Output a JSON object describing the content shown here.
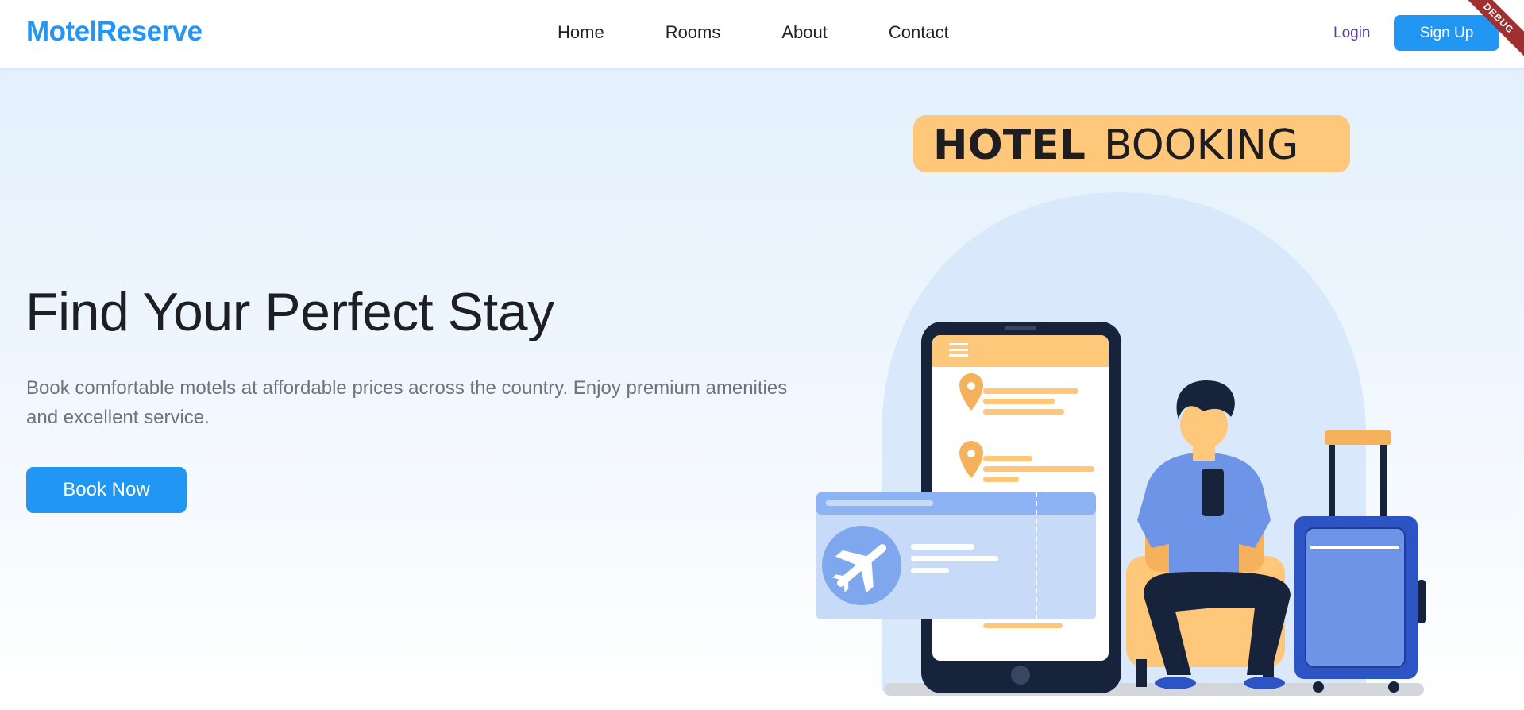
{
  "brand": {
    "name": "MotelReserve",
    "color": "#2196f3"
  },
  "nav": {
    "links": [
      "Home",
      "Rooms",
      "About",
      "Contact"
    ],
    "login_label": "Login",
    "signup_label": "Sign Up"
  },
  "debug_banner": "DEBUG",
  "hero": {
    "title": "Find Your Perfect Stay",
    "subtitle": "Book comfortable motels at affordable prices across the country. Enjoy premium amenities and excellent service.",
    "cta_label": "Book Now"
  },
  "illustration": {
    "badge_bold": "HOTEL",
    "badge_light": "BOOKING",
    "icons": [
      "phone-icon",
      "map-pin-icon",
      "boarding-pass-icon",
      "airplane-icon",
      "traveler-person",
      "suitcase-icon"
    ]
  },
  "colors": {
    "accent": "#2196f3",
    "badge": "#ffc77a",
    "dark": "#17223b",
    "login": "#5a3ea8"
  }
}
